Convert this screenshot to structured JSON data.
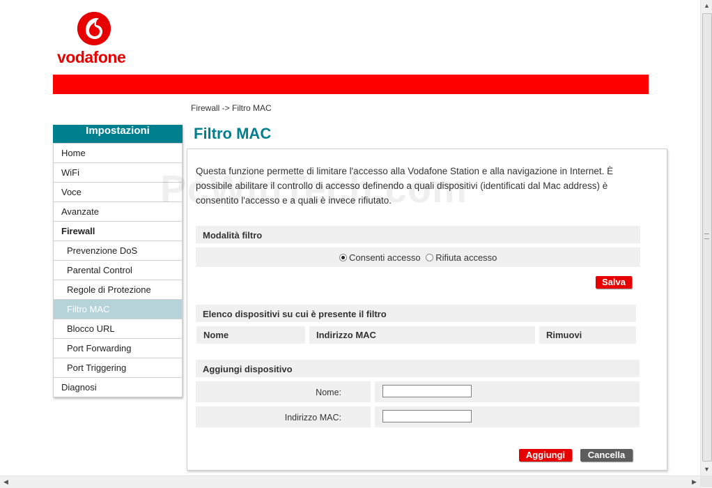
{
  "brand": {
    "name": "vodafone",
    "color": "#e60000",
    "accent": "#00808e"
  },
  "breadcrumb": "Firewall -> Filtro MAC",
  "sidebar": {
    "title": "Impostazioni",
    "items": [
      {
        "label": "Home"
      },
      {
        "label": "WiFi"
      },
      {
        "label": "Voce"
      },
      {
        "label": "Avanzate"
      },
      {
        "label": "Firewall"
      },
      {
        "label": "Prevenzione DoS"
      },
      {
        "label": "Parental Control"
      },
      {
        "label": "Regole di Protezione"
      },
      {
        "label": "Filtro MAC"
      },
      {
        "label": "Blocco URL"
      },
      {
        "label": "Port Forwarding"
      },
      {
        "label": "Port Triggering"
      },
      {
        "label": "Diagnosi"
      }
    ]
  },
  "main": {
    "title": "Filtro MAC",
    "description": "Questa funzione permette di limitare l'accesso alla Vodafone Station e alla navigazione in Internet. È possibile abilitare il controllo di accesso definendo a quali dispositivi (identificati dal Mac address) è consentito l'accesso e a quali è invece rifiutato.",
    "watermark": "PcWinTech.com",
    "filter_mode": {
      "heading": "Modalità filtro",
      "options": [
        {
          "label": "Consenti accesso",
          "selected": true
        },
        {
          "label": "Rifiuta accesso",
          "selected": false
        }
      ],
      "save_label": "Salva"
    },
    "device_list": {
      "heading": "Elenco dispositivi su cui è presente il filtro",
      "columns": [
        "Nome",
        "Indirizzo MAC",
        "Rimuovi"
      ]
    },
    "add_device": {
      "heading": "Aggiungi dispositivo",
      "name_label": "Nome:",
      "name_value": "",
      "mac_label": "Indirizzo MAC:",
      "mac_value": "",
      "add_label": "Aggiungi",
      "cancel_label": "Cancella"
    }
  }
}
